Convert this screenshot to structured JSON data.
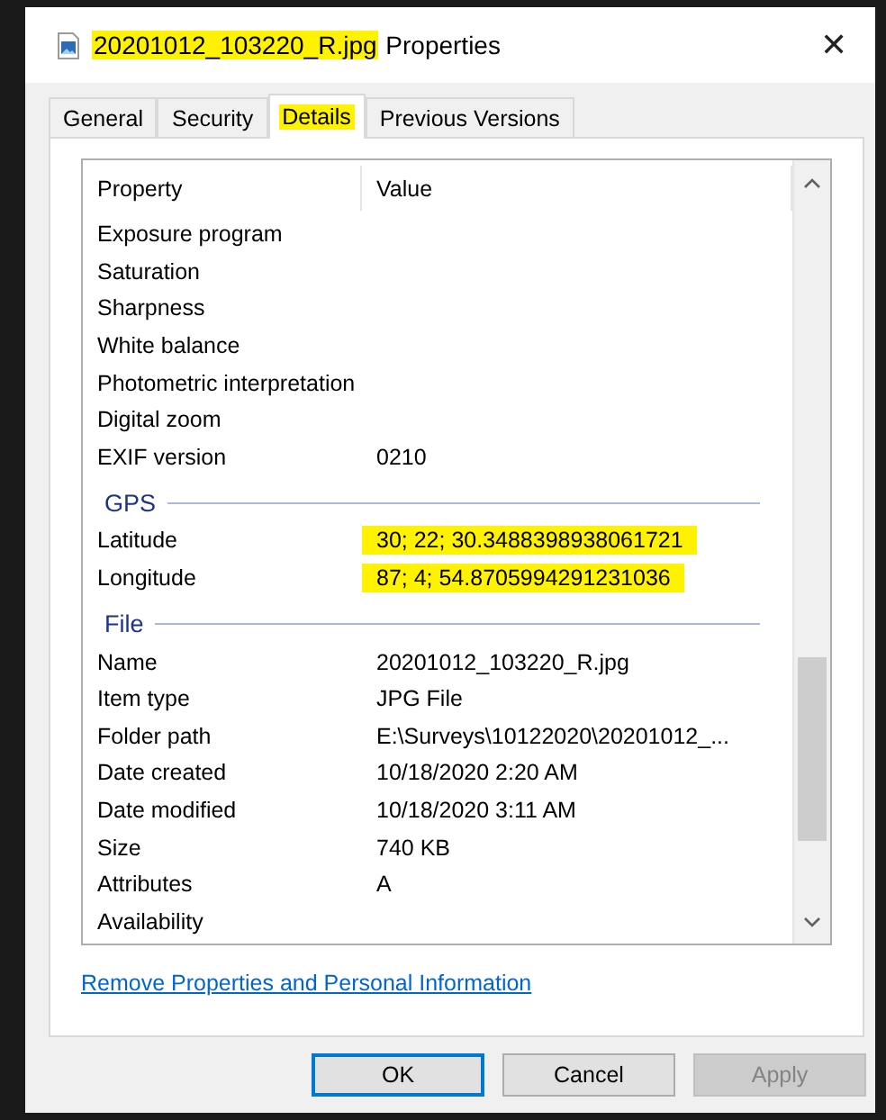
{
  "window": {
    "title_name": "20201012_103220_R.jpg",
    "title_name_highlighted": true,
    "title_suffix": "Properties",
    "close": "✕"
  },
  "tabs": [
    {
      "label": "General",
      "selected": false,
      "highlighted": false
    },
    {
      "label": "Security",
      "selected": false,
      "highlighted": false
    },
    {
      "label": "Details",
      "selected": true,
      "highlighted": true
    },
    {
      "label": "Previous Versions",
      "selected": false,
      "highlighted": false
    }
  ],
  "details": {
    "columns": [
      "Property",
      "Value"
    ],
    "rows": [
      {
        "kind": "row",
        "property": "Exposure program",
        "value": "",
        "highlighted": false
      },
      {
        "kind": "row",
        "property": "Saturation",
        "value": "",
        "highlighted": false
      },
      {
        "kind": "row",
        "property": "Sharpness",
        "value": "",
        "highlighted": false
      },
      {
        "kind": "row",
        "property": "White balance",
        "value": "",
        "highlighted": false
      },
      {
        "kind": "row",
        "property": "Photometric interpretation",
        "value": "",
        "highlighted": false
      },
      {
        "kind": "row",
        "property": "Digital zoom",
        "value": "",
        "highlighted": false
      },
      {
        "kind": "row",
        "property": "EXIF version",
        "value": "0210",
        "highlighted": false
      },
      {
        "kind": "group",
        "property": "GPS"
      },
      {
        "kind": "row",
        "property": "Latitude",
        "value": "30; 22; 30.3488398938061721",
        "highlighted": true
      },
      {
        "kind": "row",
        "property": "Longitude",
        "value": "87; 4; 54.8705994291231036",
        "highlighted": true
      },
      {
        "kind": "group",
        "property": "File"
      },
      {
        "kind": "row",
        "property": "Name",
        "value": "20201012_103220_R.jpg",
        "highlighted": false
      },
      {
        "kind": "row",
        "property": "Item type",
        "value": "JPG File",
        "highlighted": false
      },
      {
        "kind": "row",
        "property": "Folder path",
        "value": "E:\\Surveys\\10122020\\20201012_...",
        "highlighted": false
      },
      {
        "kind": "row",
        "property": "Date created",
        "value": "10/18/2020 2:20 AM",
        "highlighted": false
      },
      {
        "kind": "row",
        "property": "Date modified",
        "value": "10/18/2020 3:11 AM",
        "highlighted": false
      },
      {
        "kind": "row",
        "property": "Size",
        "value": "740 KB",
        "highlighted": false
      },
      {
        "kind": "row",
        "property": "Attributes",
        "value": "A",
        "highlighted": false
      },
      {
        "kind": "row",
        "property": "Availability",
        "value": "",
        "highlighted": false
      }
    ]
  },
  "link": "Remove Properties and Personal Information",
  "buttons": [
    {
      "label": "OK",
      "default": true,
      "disabled": false
    },
    {
      "label": "Cancel",
      "default": false,
      "disabled": false
    },
    {
      "label": "Apply",
      "default": false,
      "disabled": true
    }
  ]
}
